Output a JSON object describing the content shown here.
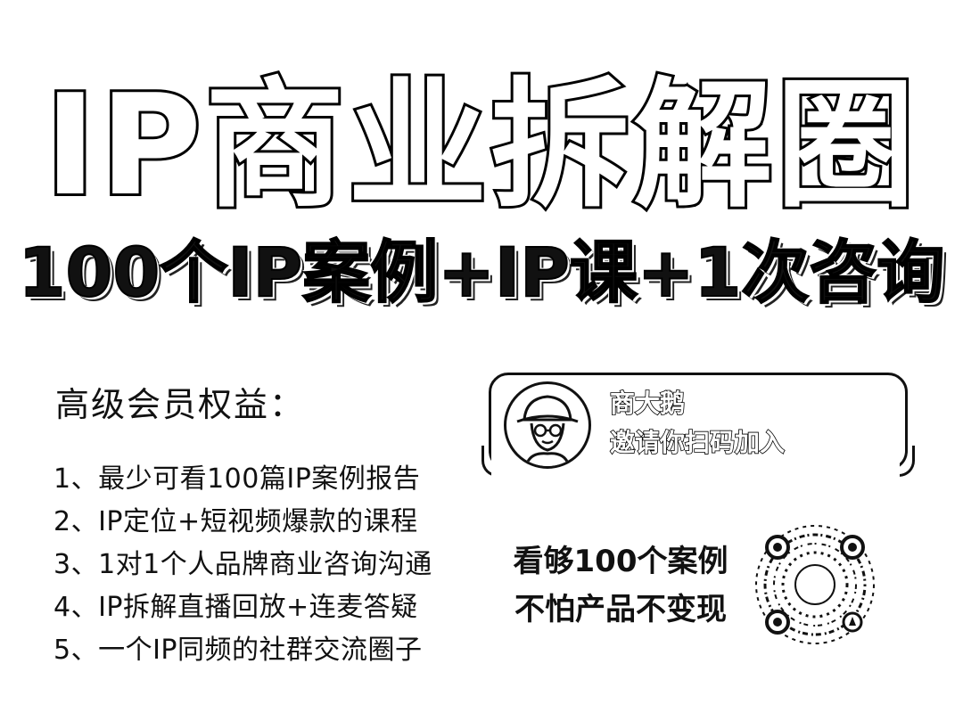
{
  "poster": {
    "title": "IP商业拆解圈",
    "subtitle": "100个IP案例+IP课+1次咨询"
  },
  "benefits": {
    "heading": "高级会员权益：",
    "items": [
      "1、最少可看100篇IP案例报告",
      "2、IP定位+短视频爆款的课程",
      "3、1对1个人品牌商业咨询沟通",
      "4、IP拆解直播回放+连麦答疑",
      "5、一个IP同频的社群交流圈子"
    ]
  },
  "card": {
    "name": "商大鹅",
    "invite": "邀请你扫码加入"
  },
  "slogan": {
    "line1": "看够100个案例",
    "line2": "不怕产品不变现"
  },
  "qr": {
    "icon": "qr-code-icon"
  }
}
